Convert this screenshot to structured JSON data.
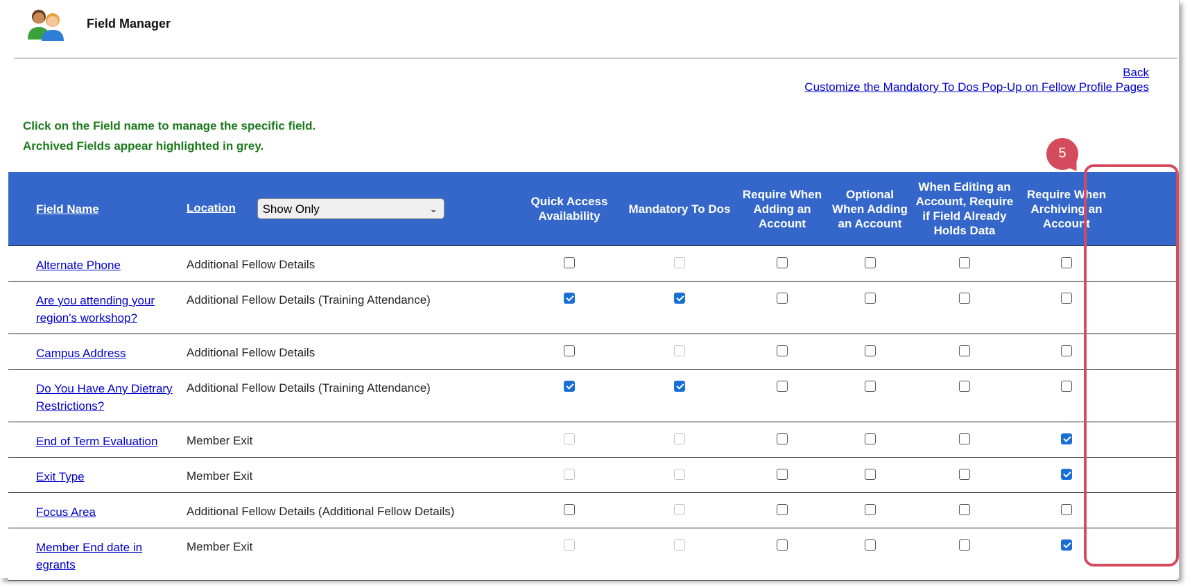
{
  "header": {
    "title": "Field Manager",
    "icon": "users-icon"
  },
  "links": {
    "back": "Back",
    "customize": "Customize the Mandatory To Dos Pop-Up on Fellow Profile Pages"
  },
  "info": {
    "line1": "Click on the Field name to manage the specific field.",
    "line2": "Archived Fields appear highlighted in grey."
  },
  "table": {
    "col_field_name": "Field Name",
    "col_location": "Location",
    "location_filter": "Show Only",
    "col_quick_access": "Quick Access Availability",
    "col_mandatory": "Mandatory To Dos",
    "col_require_adding": "Require When Adding an Account",
    "col_optional_adding": "Optional When Adding an Account",
    "col_editing": "When Editing an Account, Require if Field Already Holds Data",
    "col_archiving": "Require When Archiving an Account",
    "rows": [
      {
        "name": "Alternate Phone",
        "location": "Additional Fellow Details"
      },
      {
        "name": "Are you attending your region's workshop?",
        "location": "Additional Fellow Details (Training Attendance)"
      },
      {
        "name": "Campus Address",
        "location": "Additional Fellow Details"
      },
      {
        "name": "Do You Have Any Dietrary Restrictions?",
        "location": "Additional Fellow Details (Training Attendance)"
      },
      {
        "name": "End of Term Evaluation",
        "location": "Member Exit"
      },
      {
        "name": "Exit Type",
        "location": "Member Exit"
      },
      {
        "name": "Focus Area",
        "location": "Additional Fellow Details (Additional Fellow Details)"
      },
      {
        "name": "Member End date in egrants",
        "location": "Member Exit"
      }
    ]
  },
  "annotation": {
    "step_number": "5",
    "color": "#d54b5e"
  },
  "colors": {
    "header_bg": "#3467c9",
    "link": "#0000cc",
    "info_text": "#1a7a1a",
    "checkbox_checked": "#1a6fd4"
  }
}
